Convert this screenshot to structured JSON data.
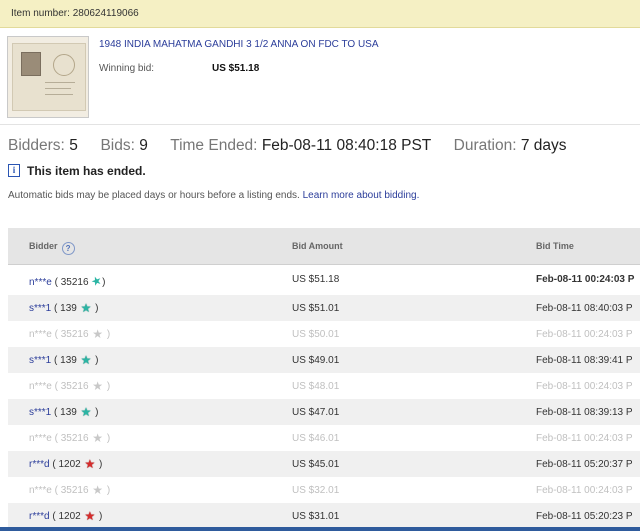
{
  "item_bar": {
    "text": "Item number: 280624119066"
  },
  "listing": {
    "title": "1948 INDIA MAHATMA GANDHI 3 1/2 ANNA ON FDC TO USA",
    "winning_bid_label": "Winning bid:",
    "winning_bid_value": "US $51.18"
  },
  "stats": {
    "bidders_label": "Bidders:",
    "bidders_value": "5",
    "bids_label": "Bids:",
    "bids_value": "9",
    "time_ended_label": "Time Ended:",
    "time_ended_value": "Feb-08-11 08:40:18 PST",
    "duration_label": "Duration:",
    "duration_value": "7 days"
  },
  "status": {
    "info_glyph": "i",
    "ended_text": "This item has ended.",
    "auto_text": "Automatic bids may be placed days or hours before a listing ends.",
    "learn_more": "Learn more about bidding."
  },
  "table": {
    "headers": {
      "bidder": "Bidder",
      "help_glyph": "?",
      "amount": "Bid Amount",
      "time": "Bid Time"
    },
    "rows": [
      {
        "name": "n***e",
        "open": " ( 35216",
        "close": ")",
        "star": "shooting-star-icon",
        "amount": "US $51.18",
        "time": "Feb-08-11 00:24:03 P"
      },
      {
        "name": "s***1",
        "open": " ( 139",
        "close": " )",
        "star": "teal-star-icon",
        "amount": "US $51.01",
        "time": "Feb-08-11 08:40:03 P"
      },
      {
        "name": "n***e",
        "open": " ( 35216",
        "close": " )",
        "star": "grey-star-icon",
        "amount": "US $50.01",
        "time": "Feb-08-11 00:24:03 P"
      },
      {
        "name": "s***1",
        "open": " ( 139",
        "close": " )",
        "star": "teal-star-icon",
        "amount": "US $49.01",
        "time": "Feb-08-11 08:39:41 P"
      },
      {
        "name": "n***e",
        "open": " ( 35216",
        "close": " )",
        "star": "grey-star-icon",
        "amount": "US $48.01",
        "time": "Feb-08-11 00:24:03 P"
      },
      {
        "name": "s***1",
        "open": " ( 139",
        "close": " )",
        "star": "teal-star-icon",
        "amount": "US $47.01",
        "time": "Feb-08-11 08:39:13 P"
      },
      {
        "name": "n***e",
        "open": " ( 35216",
        "close": " )",
        "star": "grey-star-icon",
        "amount": "US $46.01",
        "time": "Feb-08-11 00:24:03 P"
      },
      {
        "name": "r***d",
        "open": " ( 1202",
        "close": " )",
        "star": "red-star-icon",
        "amount": "US $45.01",
        "time": "Feb-08-11 05:20:37 P"
      },
      {
        "name": "n***e",
        "open": " ( 35216",
        "close": " )",
        "star": "grey-star-icon",
        "amount": "US $32.01",
        "time": "Feb-08-11 00:24:03 P"
      },
      {
        "name": "r***d",
        "open": " ( 1202",
        "close": " )",
        "star": "red-star-icon",
        "amount": "US $31.01",
        "time": "Feb-08-11 05:20:23 P"
      }
    ]
  },
  "colors": {
    "link": "#2b3d9a",
    "item_bar": "#f5f0c4",
    "header_bg": "#e5e5e5",
    "retracted": "#c0c0c0"
  }
}
